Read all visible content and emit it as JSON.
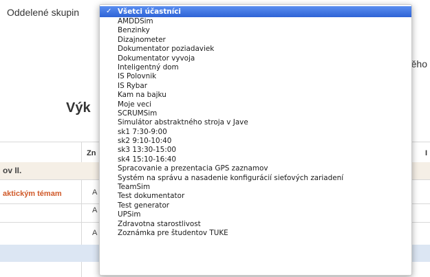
{
  "page": {
    "group_label": "Oddelené skupin",
    "right_snippet": "ěho",
    "heading": "Výk",
    "table": {
      "header_fragments": [
        "Zn",
        "I"
      ],
      "group_row_label": "ov II.",
      "topic_link": "aktickým témam",
      "cell_a": [
        "A",
        "A",
        "A"
      ]
    }
  },
  "dropdown": {
    "selected_index": 0,
    "options": [
      "Všetci účastníci",
      "AMDDSim",
      "Benzinky",
      "Dizajnometer",
      "Dokumentator poziadaviek",
      "Dokumentator vyvoja",
      "Inteligentný dom",
      "IS Polovnik",
      "IS Rybar",
      "Kam na bajku",
      "Moje veci",
      "SCRUMSim",
      "Simulátor abstraktného stroja v Jave",
      "sk1 7:30-9:00",
      "sk2 9:10-10:40",
      "sk3 13:30-15:00",
      "sk4 15:10-16:40",
      "Spracovanie a prezentacia GPS zaznamov",
      "Systém na správu a nasadenie konfigurácií sieťových zariadení",
      "TeamSim",
      "Test dokumentator",
      "Test generator",
      "UPSim",
      "Zdravotna starostlivost",
      "Zoznámka pre študentov TUKE"
    ]
  },
  "colors": {
    "selection": "#2e63d6",
    "link": "#d05a2a",
    "group_row": "#f5efe6",
    "highlight_row": "#dce6f3"
  },
  "icons": [
    "checkmark-icon"
  ]
}
